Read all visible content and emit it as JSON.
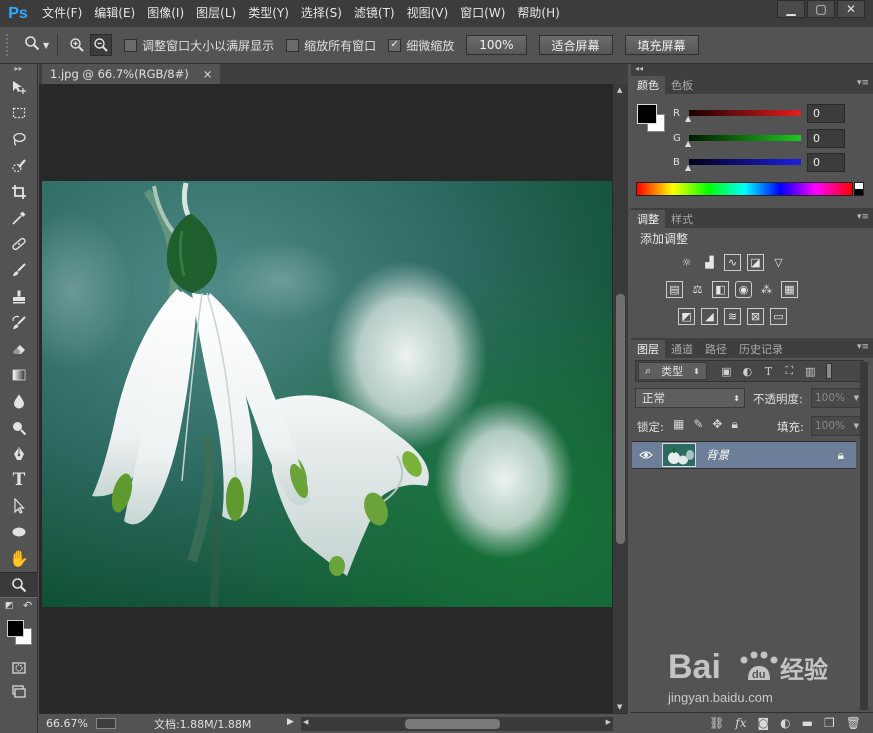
{
  "app": {
    "logo": "Ps"
  },
  "menu": [
    "文件(F)",
    "编辑(E)",
    "图像(I)",
    "图层(L)",
    "类型(Y)",
    "选择(S)",
    "滤镜(T)",
    "视图(V)",
    "窗口(W)",
    "帮助(H)"
  ],
  "window_controls": {
    "minimize": "▁",
    "restore": "▢",
    "close": "✕"
  },
  "options": {
    "resize_windows": {
      "label": "调整窗口大小以满屏显示",
      "checked": false
    },
    "zoom_all_windows": {
      "label": "缩放所有窗口",
      "checked": false
    },
    "scrubby_zoom": {
      "label": "细微缩放",
      "checked": true
    },
    "btn_100": "100%",
    "btn_fit_screen": "适合屏幕",
    "btn_fill_screen": "填充屏幕"
  },
  "tools": [
    "move-tool",
    "marquee-tool",
    "lasso-tool",
    "quick-select-tool",
    "crop-tool",
    "eyedropper-tool",
    "healing-tool",
    "brush-tool",
    "stamp-tool",
    "history-brush-tool",
    "eraser-tool",
    "gradient-tool",
    "blur-tool",
    "dodge-tool",
    "pen-tool",
    "type-tool",
    "path-select-tool",
    "shape-tool",
    "hand-tool",
    "zoom-tool"
  ],
  "document": {
    "tab_title": "1.jpg @ 66.7%(RGB/8#)",
    "tab_close": "×",
    "zoom": "66.67%",
    "doc_info": "文档:1.88M/1.88M"
  },
  "color_panel": {
    "tabs": [
      "颜色",
      "色板"
    ],
    "r": {
      "label": "R",
      "value": "0",
      "color": "#e41e1e"
    },
    "g": {
      "label": "G",
      "value": "0",
      "color": "#1ec81e"
    },
    "b": {
      "label": "B",
      "value": "0",
      "color": "#1e1ee6"
    }
  },
  "adjust_panel": {
    "tabs": [
      "调整",
      "样式"
    ],
    "title": "添加调整"
  },
  "layers_panel": {
    "tabs": [
      "图层",
      "通道",
      "路径",
      "历史记录"
    ],
    "filter_kind": "类型",
    "blend_mode": "正常",
    "opacity_label": "不透明度:",
    "opacity_value": "100%",
    "lock_label": "锁定:",
    "fill_label": "填充:",
    "fill_value": "100%",
    "layer_name": "背景"
  },
  "watermark": {
    "brand": "Baidu经验",
    "url": "jingyan.baidu.com"
  }
}
